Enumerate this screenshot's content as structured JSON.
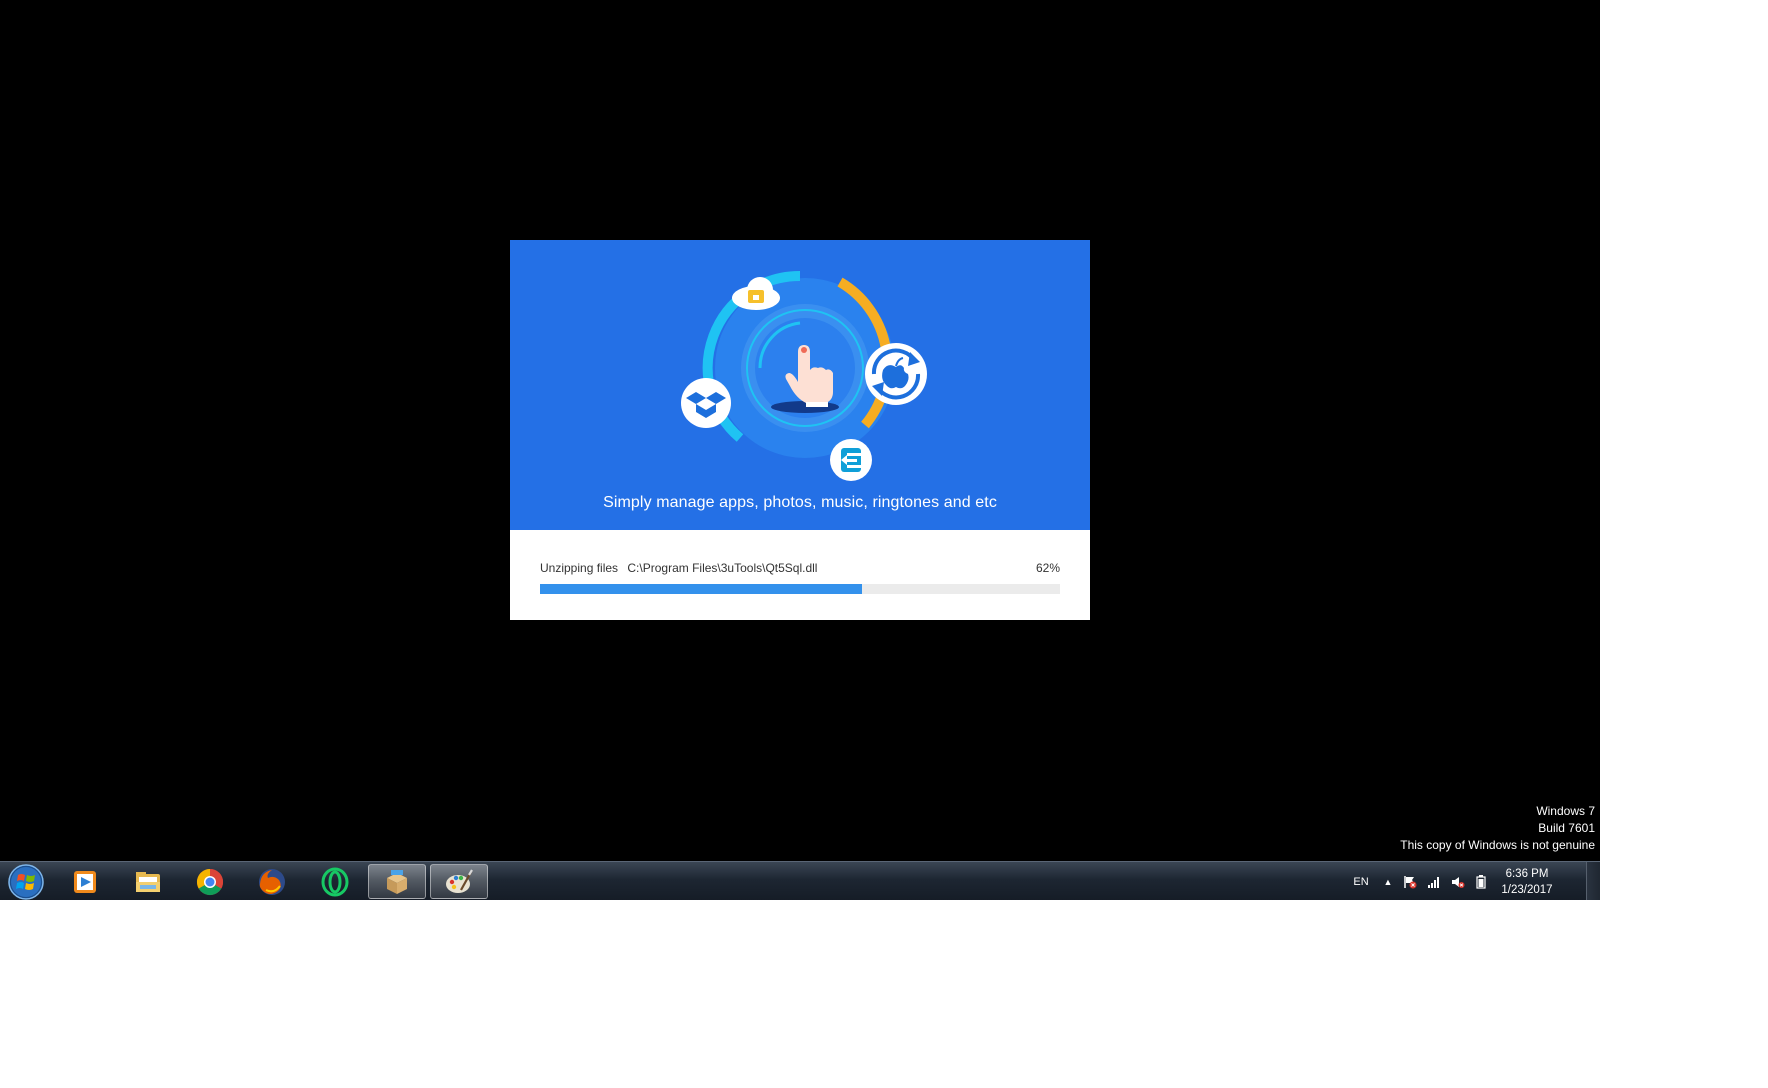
{
  "installer": {
    "tagline": "Simply manage apps, photos, music, ringtones and etc",
    "status_label": "Unzipping files",
    "status_path": "C:\\Program Files\\3uTools\\Qt5Sql.dll",
    "progress_text": "62%",
    "progress_fraction": 0.62,
    "colors": {
      "banner": "#2470e6",
      "progress_fill": "#3391ec",
      "progress_track": "#ebebeb"
    },
    "icons": [
      "hand-pointer-icon",
      "cloud-lock-icon",
      "dropbox-icon",
      "apple-sync-icon",
      "easy-transfer-icon"
    ]
  },
  "watermark": {
    "line1": "Windows 7",
    "line2": "Build 7601",
    "line3": "This copy of Windows is not genuine"
  },
  "taskbar": {
    "pinned": [
      {
        "icon": "start-orb-icon"
      },
      {
        "icon": "media-player-icon"
      },
      {
        "icon": "file-explorer-icon"
      },
      {
        "icon": "chrome-icon"
      },
      {
        "icon": "firefox-icon"
      },
      {
        "icon": "opera-icon"
      },
      {
        "icon": "installer-package-icon",
        "active": true
      },
      {
        "icon": "paint-icon",
        "active": true
      }
    ],
    "tray": {
      "language": "EN",
      "icons": [
        "show-hidden-icons",
        "action-center-flag-icon",
        "network-signal-icon",
        "volume-muted-icon",
        "battery-icon"
      ],
      "time": "6:36 PM",
      "date": "1/23/2017"
    }
  }
}
